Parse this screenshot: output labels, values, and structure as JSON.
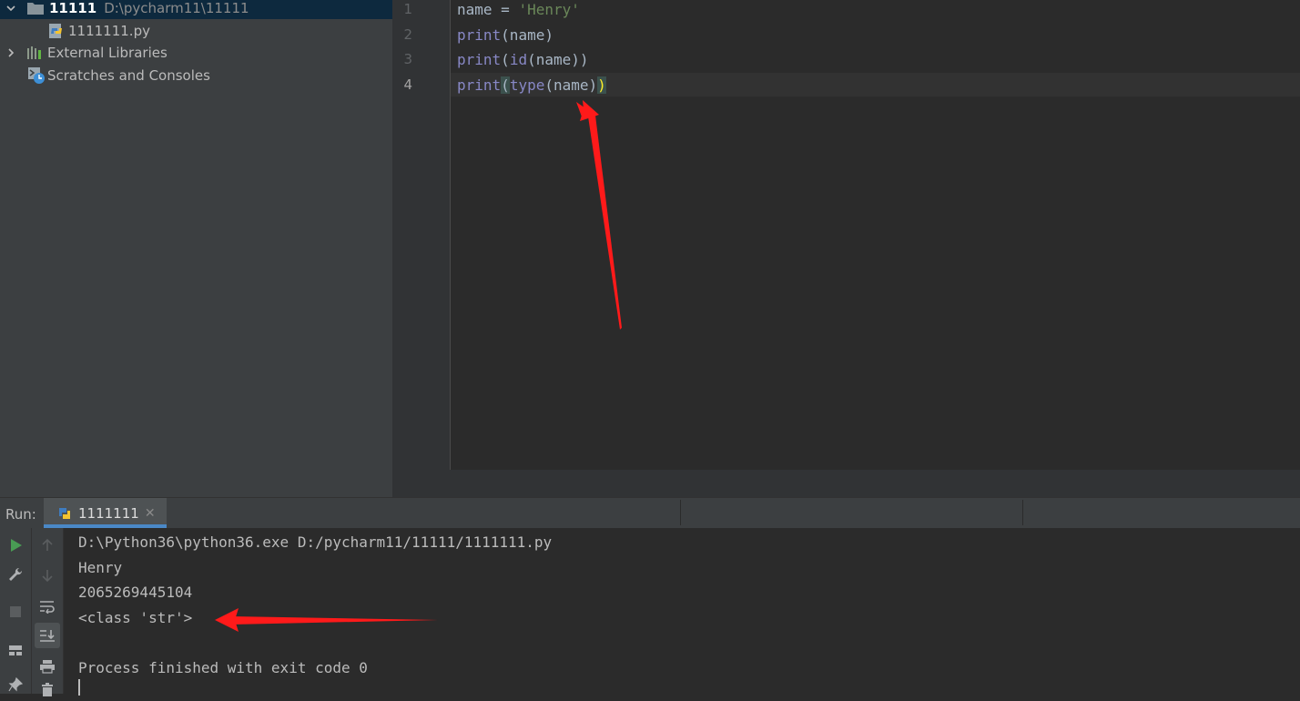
{
  "project": {
    "root": {
      "name": "11111",
      "path": "D:\\pycharm11\\11111"
    },
    "file": "1111111.py",
    "external_libraries": "External Libraries",
    "scratches": "Scratches and Consoles"
  },
  "editor": {
    "line_numbers": [
      "1",
      "2",
      "3",
      "4"
    ],
    "line1": {
      "var": "name",
      "op": " = ",
      "str": "'Henry'"
    },
    "line2": {
      "fn": "print",
      "rest": "(name)"
    },
    "line3": {
      "fn": "print",
      "open": "(",
      "fn2": "id",
      "rest": "(name))"
    },
    "line4": {
      "fn": "print",
      "open": "(",
      "fn2": "type",
      "rest": "(name)",
      "close": ")"
    }
  },
  "run": {
    "label": "Run:",
    "tab_label": "1111111",
    "tab_close": "✕",
    "output": [
      "D:\\Python36\\python36.exe D:/pycharm11/11111/1111111.py",
      "Henry",
      "2065269445104",
      "<class 'str'>",
      "",
      "Process finished with exit code 0"
    ]
  },
  "icons": {
    "run": "run-icon",
    "wrench": "wrench-icon",
    "stop": "stop-icon",
    "layout": "layout-icon",
    "pin": "pin-icon",
    "up": "arrow-up-icon",
    "down": "arrow-down-icon",
    "soft_wrap": "soft-wrap-icon",
    "scroll_end": "scroll-to-end-icon",
    "print": "print-icon",
    "trash": "trash-icon"
  },
  "colors": {
    "annotation_arrow": "#ff1a1a",
    "keyword": "#8888c6",
    "string": "#6a8759"
  }
}
